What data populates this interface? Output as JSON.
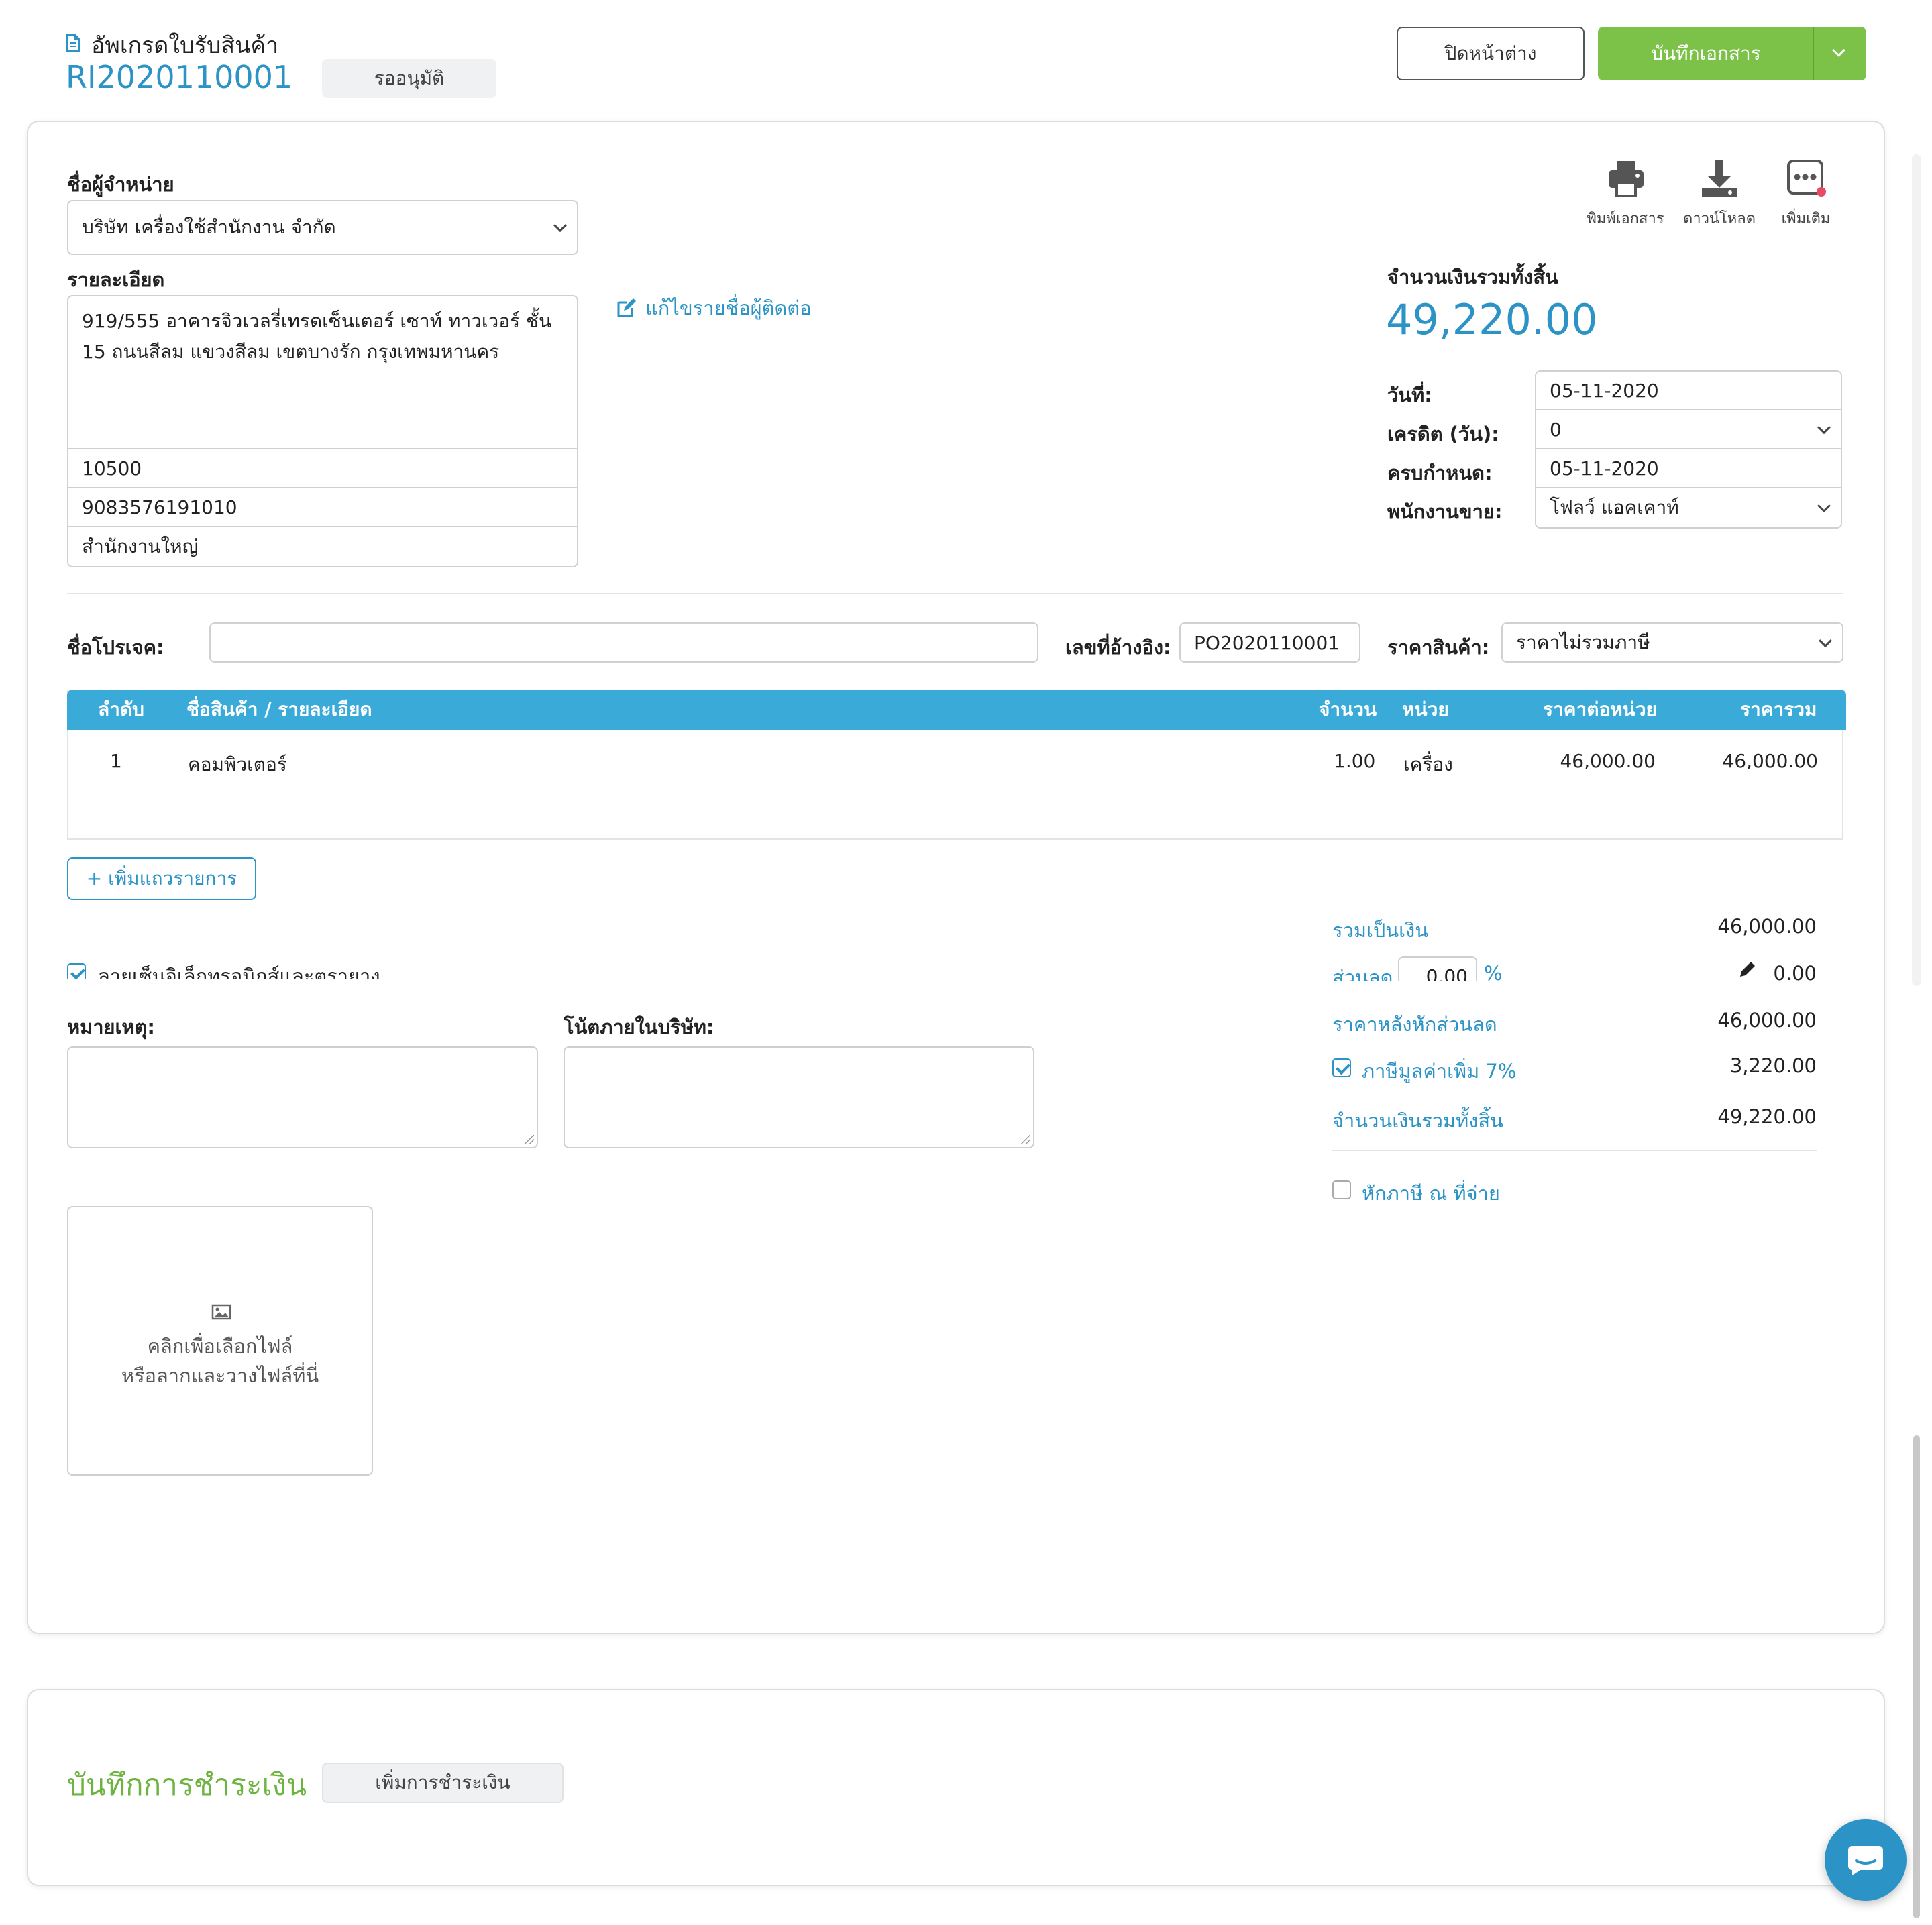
{
  "header": {
    "doc_title": "อัพเกรดใบรับสินค้า",
    "doc_number": "RI2020110001",
    "status": "รออนุมัติ",
    "close_label": "ปิดหน้าต่าง",
    "save_label": "บันทึกเอกสาร"
  },
  "vendor": {
    "name_label": "ชื่อผู้จำหน่าย",
    "name_value": "บริษัท เครื่องใช้สำนักงาน จำกัด",
    "detail_label": "รายละเอียด",
    "address_line1": "919/555 อาคารจิวเวลรี่เทรดเซ็นเตอร์ เซาท์ ทาวเวอร์ ชั้น",
    "address_line2": "15 ถนนสีลม แขวงสีลม เขตบางรัก กรุงเทพมหานคร",
    "postal_code": "10500",
    "tax_id": "9083576191010",
    "branch": "สำนักงานใหญ่",
    "edit_contact_label": "แก้ไขรายชื่อผู้ติดต่อ"
  },
  "actions": {
    "print_label": "พิมพ์เอกสาร",
    "download_label": "ดาวน์โหลด",
    "more_label": "เพิ่มเติม"
  },
  "totals_header": {
    "label": "จำนวนเงินรวมทั้งสิ้น",
    "value": "49,220.00"
  },
  "meta": {
    "date_label": "วันที่:",
    "date_value": "05-11-2020",
    "credit_label": "เครดิต (วัน):",
    "credit_value": "0",
    "due_label": "ครบกำหนด:",
    "due_value": "05-11-2020",
    "sales_label": "พนักงานขาย:",
    "sales_value": "โฟลว์ แอคเคาท์"
  },
  "project": {
    "project_label": "ชื่อโปรเจค:",
    "project_value": "",
    "ref_label": "เลขที่อ้างอิง:",
    "ref_value": "PO2020110001",
    "price_label": "ราคาสินค้า:",
    "price_value": "ราคาไม่รวมภาษี"
  },
  "table": {
    "headers": {
      "seq": "ลำดับ",
      "name": "ชื่อสินค้า / รายละเอียด",
      "qty": "จำนวน",
      "unit": "หน่วย",
      "unit_price": "ราคาต่อหน่วย",
      "total": "ราคารวม"
    },
    "rows": [
      {
        "seq": "1",
        "name": "คอมพิวเตอร์",
        "qty": "1.00",
        "unit": "เครื่อง",
        "unit_price": "46,000.00",
        "total": "46,000.00"
      }
    ],
    "add_row_label": "+ เพิ่มแถวรายการ"
  },
  "signature_label": "ลายเซ็นอิเล็กทรอนิกส์และตรายาง",
  "notes": {
    "remark_label": "หมายเหตุ:",
    "internal_label": "โน้ตภายในบริษัท:"
  },
  "upload": {
    "line1": "คลิกเพื่อเลือกไฟล์",
    "line2": "หรือลากและวางไฟล์ที่นี่"
  },
  "summary": {
    "subtotal_label": "รวมเป็นเงิน",
    "subtotal_value": "46,000.00",
    "discount_label": "ส่วนลด",
    "discount_input": "0.00",
    "discount_unit": "%",
    "discount_value": "0.00",
    "after_discount_label": "ราคาหลังหักส่วนลด",
    "after_discount_value": "46,000.00",
    "vat_label": "ภาษีมูลค่าเพิ่ม 7%",
    "vat_value": "3,220.00",
    "grand_label": "จำนวนเงินรวมทั้งสิ้น",
    "grand_value": "49,220.00",
    "withholding_label": "หักภาษี ณ ที่จ่าย"
  },
  "payment": {
    "title": "บันทึกการชำระเงิน",
    "add_label": "เพิ่มการชำระเงิน"
  },
  "colors": {
    "accent": "#2b93c5",
    "table_header": "#3aaad8",
    "save_button": "#7cc249",
    "payment_title": "#6db33f",
    "notify_dot": "#e84a5f"
  },
  "icons": {
    "doc": "document-icon",
    "print": "printer-icon",
    "download": "download-icon",
    "more": "more-dots-icon",
    "edit": "edit-icon",
    "image": "image-icon",
    "chat": "chat-icon"
  }
}
